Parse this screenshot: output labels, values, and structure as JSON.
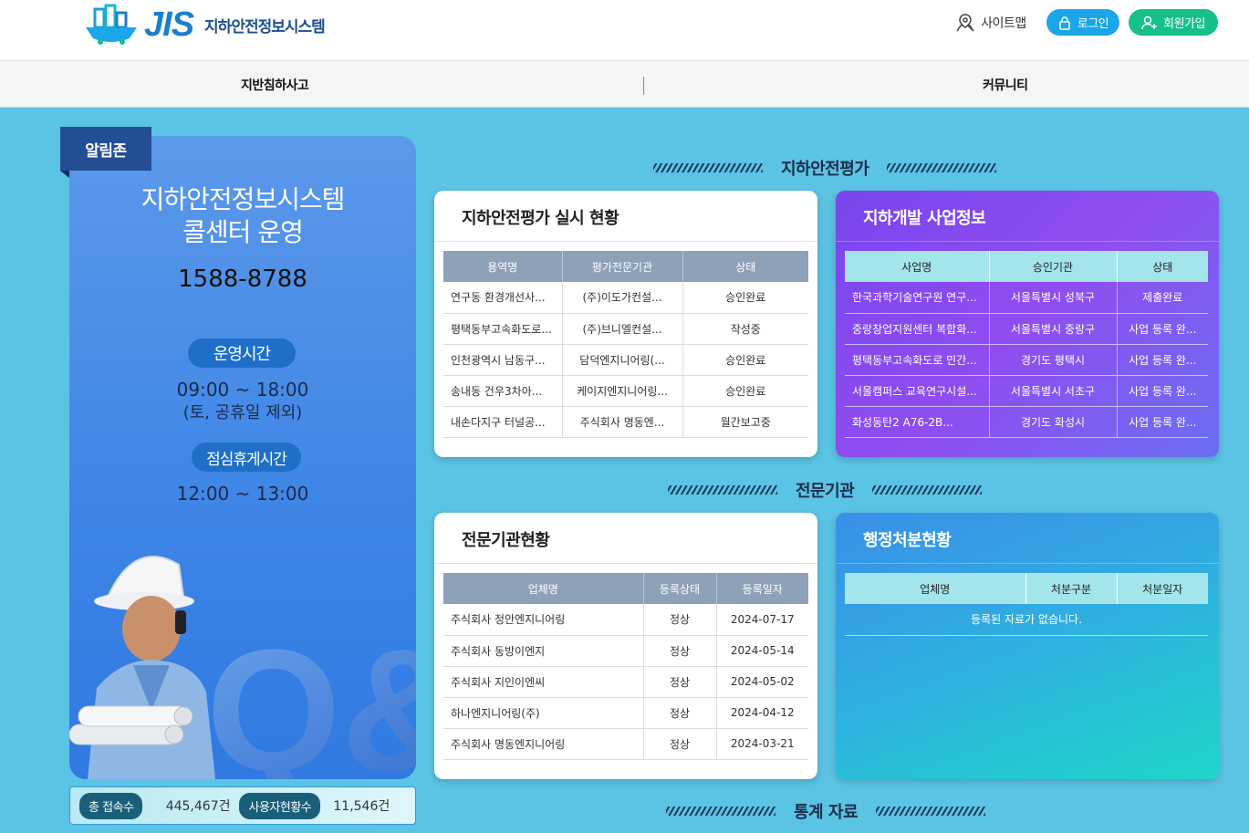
{
  "header": {
    "logo_word": "JIS",
    "logo_text": "지하안전정보시스템",
    "sitemap": "사이트맵",
    "login": "로그인",
    "join": "회원가입"
  },
  "nav": [
    "지반침하사고",
    "커뮤니티"
  ],
  "notice": {
    "tab": "알림존",
    "title_line1": "지하안전정보시스템",
    "title_line2": "콜센터 운영",
    "phone": "1588-8788",
    "hours_badge": "운영시간",
    "hours": "09:00 ~ 18:00",
    "hours_note": "(토, 공휴일 제외)",
    "lunch_badge": "점심휴게시간",
    "lunch": "12:00 ~ 13:00",
    "art_text": "Q&A"
  },
  "stats": {
    "total_label": "총 접속수",
    "total_value": "445,467건",
    "users_label": "사용자현황수",
    "users_value": "11,546건"
  },
  "sections": [
    "지하안전평가",
    "전문기관",
    "통계 자료"
  ],
  "eval": {
    "title": "지하안전평가 실시 현황",
    "headers": [
      "용역명",
      "평가전문기관",
      "상태"
    ],
    "rows": [
      [
        "연구동 환경개선사...",
        "(주)이도가컨설...",
        "승인완료"
      ],
      [
        "평택동부고속화도로...",
        "(주)브니엘컨설...",
        "작성중"
      ],
      [
        "인천광역시 남동구...",
        "담덕엔지니어링(...",
        "승인완료"
      ],
      [
        "송내동 건우3차아...",
        "케이지엔지니어링...",
        "승인완료"
      ],
      [
        "내손다지구 터널공...",
        "주식회사 명동엔...",
        "월간보고중"
      ]
    ]
  },
  "projects": {
    "title": "지하개발 사업정보",
    "headers": [
      "사업명",
      "승인기관",
      "상태"
    ],
    "rows": [
      [
        "한국과학기술연구원 연구...",
        "서울특별시 성북구",
        "제출완료"
      ],
      [
        "중랑창업지원센터 복합화...",
        "서울특별시 중랑구",
        "사업 등록 완..."
      ],
      [
        "평택동부고속화도로 민간...",
        "경기도 평택시",
        "사업 등록 완..."
      ],
      [
        "서울캠퍼스 교육연구시설...",
        "서울특별시 서초구",
        "사업 등록 완..."
      ],
      [
        "화성동탄2 A76-2B...",
        "경기도 화성시",
        "사업 등록 완..."
      ]
    ]
  },
  "agencies": {
    "title": "전문기관현황",
    "headers": [
      "업체명",
      "등록상태",
      "등록일자"
    ],
    "rows": [
      [
        "주식회사 정안엔지니어링",
        "정상",
        "2024-07-17"
      ],
      [
        "주식회사 동방이엔지",
        "정상",
        "2024-05-14"
      ],
      [
        "주식회사 지인이엔씨",
        "정상",
        "2024-05-02"
      ],
      [
        "하나엔지니어링(주)",
        "정상",
        "2024-04-12"
      ],
      [
        "주식회사 명동엔지니어링",
        "정상",
        "2024-03-21"
      ]
    ]
  },
  "admin": {
    "title": "행정처분현황",
    "headers": [
      "업체명",
      "처분구분",
      "처분일자"
    ],
    "empty": "등록된 자료가 없습니다."
  },
  "colors": {
    "page_bg": "#5bc3e4",
    "brand_blue": "#1a7fd1",
    "login_pill": "#1aa6e8",
    "join_pill": "#16c08a",
    "purple_card": "#8a4cf0",
    "teal_card": "#1ed6c8"
  }
}
